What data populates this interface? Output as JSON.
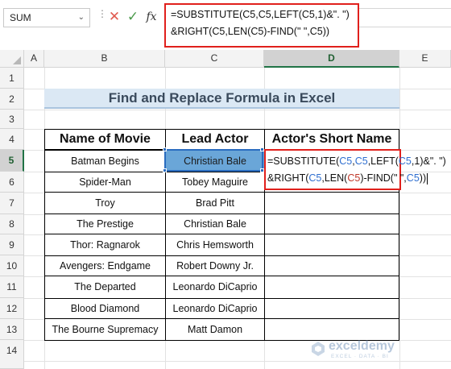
{
  "formula_bar": {
    "name_box": "SUM",
    "name_box_arrow": "⌄",
    "cancel_icon": "✕",
    "enter_icon": "✓",
    "fx_label": "fx",
    "formula_line1": "=SUBSTITUTE(C5,C5,LEFT(C5,1)&\". \")",
    "formula_line2": "&RIGHT(C5,LEN(C5)-FIND(\" \",C5))"
  },
  "columns": [
    "A",
    "B",
    "C",
    "D",
    "E"
  ],
  "active_column": "D",
  "rows": [
    "1",
    "2",
    "3",
    "4",
    "5",
    "6",
    "7",
    "8",
    "9",
    "10",
    "11",
    "12",
    "13",
    "14"
  ],
  "active_row": "5",
  "title": "Find and Replace Formula in Excel",
  "table": {
    "headers": [
      "Name of Movie",
      "Lead Actor",
      "Actor's Short Name"
    ],
    "rows": [
      [
        "Batman Begins",
        "Christian Bale",
        ""
      ],
      [
        "Spider-Man",
        "Tobey Maguire",
        ""
      ],
      [
        "Troy",
        "Brad Pitt",
        ""
      ],
      [
        "The Prestige",
        "Christian Bale",
        ""
      ],
      [
        "Thor: Ragnarok",
        "Chris Hemsworth",
        ""
      ],
      [
        "Avengers: Endgame",
        "Robert Downy Jr.",
        ""
      ],
      [
        "The Departed",
        "Leonardo DiCaprio",
        ""
      ],
      [
        "Blood Diamond",
        "Leonardo DiCaprio",
        ""
      ],
      [
        "The Bourne Supremacy",
        "Matt Damon",
        ""
      ]
    ]
  },
  "edit_cell": {
    "l1_a": "=SUBSTITUTE(",
    "l1_b": "C5",
    "l1_c": ",",
    "l1_d": "C5",
    "l1_e": ",LEFT(",
    "l1_f": "C5",
    "l1_g": ",1)&\". \")",
    "l2_a": "&RIGHT(",
    "l2_b": "C5",
    "l2_c": ",LEN(",
    "l2_d": "C5",
    "l2_e": ")-FIND(\" \",",
    "l2_f": "C5",
    "l2_g": "))"
  },
  "watermark": {
    "name": "exceldemy",
    "tagline": "EXCEL · DATA · BI"
  },
  "colors": {
    "accent_red": "#e0201c",
    "selection_blue": "#2a6cbf",
    "title_fill": "#dbe8f4",
    "header_active": "#217346"
  }
}
